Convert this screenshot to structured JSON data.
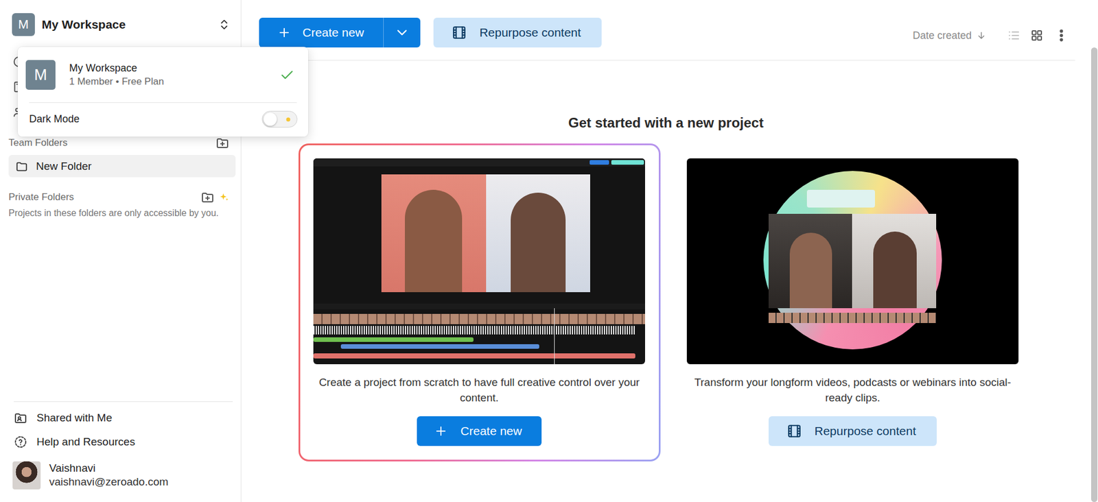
{
  "workspace": {
    "avatar": "M",
    "name": "My Workspace"
  },
  "workspace_menu": {
    "workspaces": [
      {
        "avatar": "M",
        "name": "My Workspace",
        "meta": "1 Member • Free Plan",
        "selected": true
      }
    ],
    "dark_mode": {
      "label": "Dark Mode",
      "on": false
    }
  },
  "team_folders": {
    "title": "Team Folders",
    "items": [
      {
        "label": "New Folder",
        "selected": true
      }
    ]
  },
  "private_folders": {
    "title": "Private Folders",
    "note": "Projects in these folders are only accessible by you."
  },
  "footer_links": [
    {
      "label": "Shared with Me",
      "kind": "shared"
    },
    {
      "label": "Help and Resources",
      "kind": "help"
    }
  ],
  "user": {
    "name": "Vaishnavi",
    "email": "vaishnavi@zeroado.com"
  },
  "toolbar": {
    "create": "Create new",
    "repurpose": "Repurpose content",
    "sort": "Date created",
    "views": [
      {
        "kind": "list",
        "selected": false
      },
      {
        "kind": "grid",
        "selected": true
      }
    ]
  },
  "hero": {
    "title": "Get started with a new project",
    "cards": [
      {
        "kind": "create",
        "highlighted": true,
        "description": "Create a project from scratch to have full creative control over your content.",
        "button": "Create new"
      },
      {
        "kind": "repurpose",
        "highlighted": false,
        "description": "Transform your longform videos, podcasts or webinars into social-ready clips.",
        "button": "Repurpose content"
      }
    ]
  }
}
